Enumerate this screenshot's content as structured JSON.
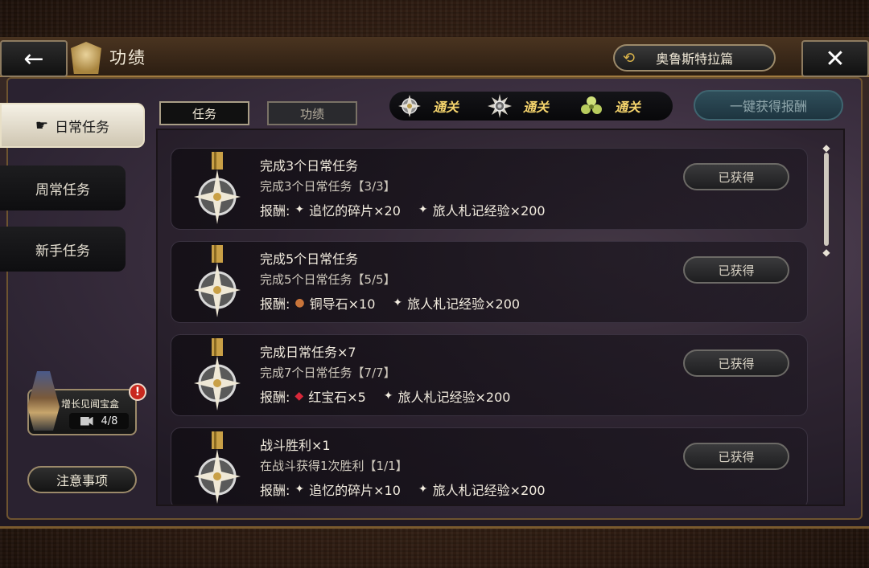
{
  "header": {
    "title": "功绩",
    "chapter_label": "奥鲁斯特拉篇",
    "back_glyph": "←",
    "close_glyph": "✕"
  },
  "sidebar": {
    "items": [
      {
        "label": "日常任务",
        "active": true
      },
      {
        "label": "周常任务",
        "active": false
      },
      {
        "label": "新手任务",
        "active": false
      }
    ],
    "treasure": {
      "label": "增长见闻宝盒",
      "progress": "4/8",
      "alert": "!"
    },
    "notice_label": "注意事项"
  },
  "tabs": [
    {
      "label": "任务",
      "active": true
    },
    {
      "label": "功绩",
      "active": false
    }
  ],
  "clear_strip": [
    {
      "label": "通关",
      "medal": "silver-star-medal"
    },
    {
      "label": "通关",
      "medal": "silver-sun-medal"
    },
    {
      "label": "通关",
      "medal": "clover-medal"
    }
  ],
  "claim_all_label": "一键获得报酬",
  "reward_prefix": "报酬:",
  "tasks": [
    {
      "title": "完成3个日常任务",
      "desc": "完成3个日常任务【3/3】",
      "rewards": [
        {
          "icon": "star-shard-icon",
          "text": "追忆的碎片×20"
        },
        {
          "icon": "star-shard-icon",
          "text": "旅人札记经验×200"
        }
      ],
      "status": "已获得"
    },
    {
      "title": "完成5个日常任务",
      "desc": "完成5个日常任务【5/5】",
      "rewards": [
        {
          "icon": "copper-ore-icon",
          "text": "铜导石×10"
        },
        {
          "icon": "star-shard-icon",
          "text": "旅人札记经验×200"
        }
      ],
      "status": "已获得"
    },
    {
      "title": "完成日常任务×7",
      "desc": "完成7个日常任务【7/7】",
      "rewards": [
        {
          "icon": "ruby-icon",
          "text": "红宝石×5"
        },
        {
          "icon": "star-shard-icon",
          "text": "旅人札记经验×200"
        }
      ],
      "status": "已获得"
    },
    {
      "title": "战斗胜利×1",
      "desc": "在战斗获得1次胜利【1/1】",
      "rewards": [
        {
          "icon": "star-shard-icon",
          "text": "追忆的碎片×10"
        },
        {
          "icon": "star-shard-icon",
          "text": "旅人札记经验×200"
        }
      ],
      "status": "已获得"
    }
  ],
  "colors": {
    "gold": "#f4d36c",
    "frame": "#9c8a6a",
    "alert": "#c8281e"
  }
}
